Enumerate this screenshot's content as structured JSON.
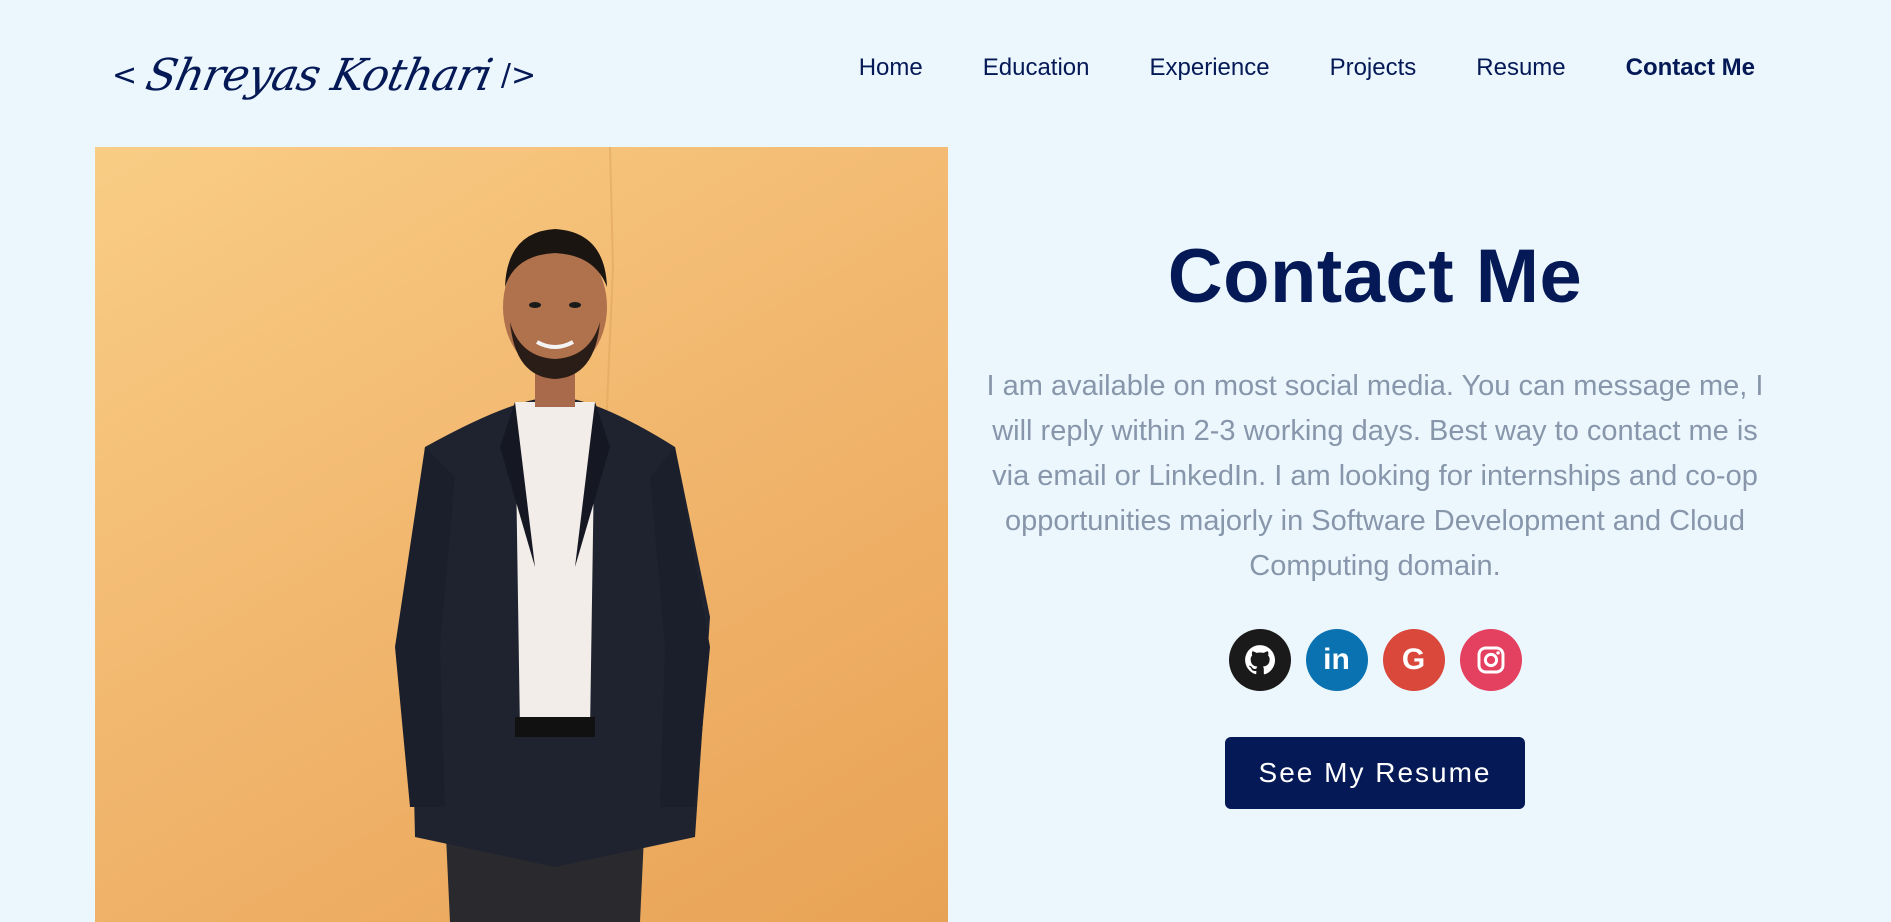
{
  "header": {
    "logo": {
      "open_bracket": "<",
      "signature": "Shreyas Kothari",
      "close_bracket": "/>"
    },
    "nav": [
      {
        "label": "Home"
      },
      {
        "label": "Education"
      },
      {
        "label": "Experience"
      },
      {
        "label": "Projects"
      },
      {
        "label": "Resume"
      },
      {
        "label": "Contact Me",
        "active": true
      }
    ]
  },
  "hero": {
    "photo_icon": "portrait-photo"
  },
  "contact": {
    "title": "Contact Me",
    "description": "I am available on most social media. You can message me, I will reply within 2-3 working days. Best way to contact me is via email or LinkedIn. I am looking for internships and co-op opportunities majorly in Software Development and Cloud Computing domain.",
    "socials": [
      {
        "icon": "github-icon",
        "color": "#1a1a1a"
      },
      {
        "icon": "linkedin-icon",
        "glyph": "in",
        "color": "#0a72b1"
      },
      {
        "icon": "google-icon",
        "glyph": "G",
        "color": "#d9483b"
      },
      {
        "icon": "instagram-icon",
        "color": "#e4405f"
      }
    ],
    "resume_button": "See My Resume"
  },
  "colors": {
    "background": "#ecf7fd",
    "primary": "#041955",
    "muted_text": "#8796ab"
  }
}
